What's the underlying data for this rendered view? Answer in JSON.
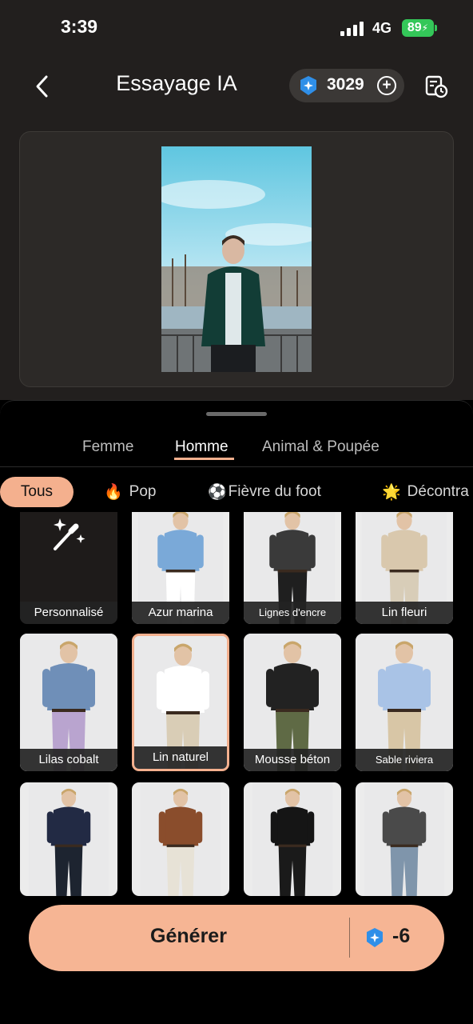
{
  "status_bar": {
    "time": "3:39",
    "network": "4G",
    "battery": "89"
  },
  "header": {
    "title": "Essayage IA",
    "credits": "3029"
  },
  "gender_tabs": [
    {
      "label": "Femme"
    },
    {
      "label": "Homme"
    },
    {
      "label": "Animal & Poupée"
    }
  ],
  "style_chips": [
    {
      "label": "Tous"
    },
    {
      "emoji": "🔥",
      "label": "Pop"
    },
    {
      "emoji": "⚽",
      "label": "Fièvre du foot"
    },
    {
      "emoji": "🌟",
      "label": "Décontra"
    }
  ],
  "outfits": [
    {
      "label": "Personnalisé",
      "custom": true
    },
    {
      "label": "Azur marina",
      "top": "#7aa9d8",
      "bottom": "#ffffff"
    },
    {
      "label": "Lignes d'encre",
      "top": "#3a3a3a",
      "bottom": "#1f1f1f"
    },
    {
      "label": "Lin fleuri",
      "top": "#d9c8ad",
      "bottom": "#d8cdb8"
    },
    {
      "label": "Lilas cobalt",
      "top": "#6f8fb8",
      "bottom": "#b9a4cf"
    },
    {
      "label": "Lin naturel",
      "top": "#ffffff",
      "bottom": "#d9cdb6",
      "selected": true
    },
    {
      "label": "Mousse béton",
      "top": "#222222",
      "bottom": "#5f6a45"
    },
    {
      "label": "Sable riviera",
      "top": "#a9c3e6",
      "bottom": "#d8c6a6"
    },
    {
      "label": "",
      "top": "#222a44",
      "bottom": "#1d2430"
    },
    {
      "label": "",
      "top": "#8a4d2c",
      "bottom": "#e7e2d6"
    },
    {
      "label": "",
      "top": "#151515",
      "bottom": "#1a1a1a"
    },
    {
      "label": "",
      "top": "#4a4a4a",
      "bottom": "#7f95ab"
    }
  ],
  "generate": {
    "label": "Générer",
    "cost": "-6"
  }
}
